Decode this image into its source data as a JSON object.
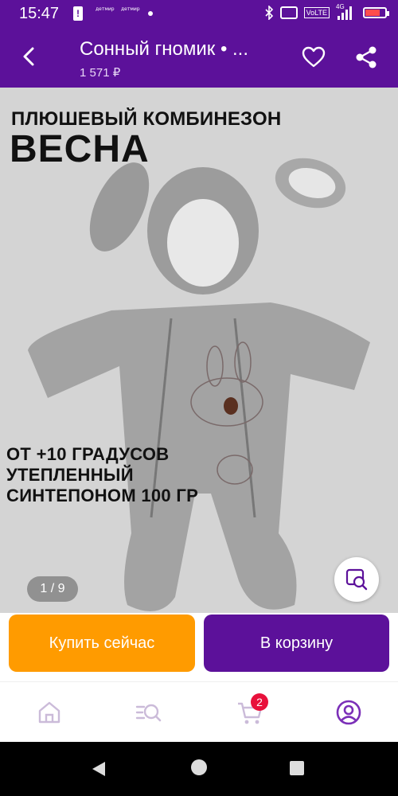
{
  "status_bar": {
    "time": "15:47",
    "left_icons": [
      "!",
      "детмир",
      "детмир"
    ],
    "network": "VoLTE",
    "network_type": "4G"
  },
  "app_bar": {
    "title": "Сонный гномик • ...",
    "price": "1 571 ₽",
    "icons": [
      "back-arrow-icon",
      "heart-icon",
      "share-icon"
    ]
  },
  "product_image": {
    "headline_line1": "ПЛЮШЕВЫЙ КОМБИНЕЗОН",
    "headline_line2": "ВЕСНА",
    "feature_line1": "ОТ +10 ГРАДУСОВ",
    "feature_line2": "УТЕПЛЕННЫЙ",
    "feature_line3": "СИНТЕПОНОМ 100 ГР",
    "counter": "1 / 9"
  },
  "actions": {
    "buy_now": "Купить сейчас",
    "add_to_cart": "В корзину"
  },
  "bottom_nav": {
    "cart_badge": "2",
    "items": [
      "home-icon",
      "catalog-search-icon",
      "cart-icon",
      "profile-icon"
    ]
  },
  "colors": {
    "brand": "#5c119a",
    "buy_button": "#ff9b00",
    "badge": "#e8113b"
  }
}
